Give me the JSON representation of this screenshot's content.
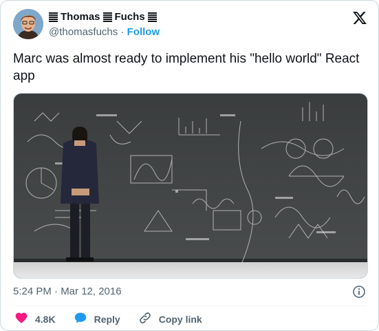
{
  "author": {
    "display_name_first": "Thomas",
    "display_name_last": "Fuchs",
    "handle": "@thomasfuchs",
    "separator": "·",
    "follow_label": "Follow"
  },
  "tweet": {
    "text": "Marc was almost ready to implement his \"hello world\" React app",
    "timestamp": "5:24 PM · Mar 12, 2016"
  },
  "actions": {
    "likes_count": "4.8K",
    "reply_label": "Reply",
    "copy_link_label": "Copy link"
  },
  "icons": {
    "logo": "x-logo-icon",
    "info": "info-icon",
    "like": "heart-icon",
    "reply": "reply-bubble-icon",
    "link": "link-icon"
  },
  "colors": {
    "follow": "#1d9bf0",
    "heart": "#f91880",
    "reply": "#1d9bf0",
    "secondary_text": "#536471"
  }
}
